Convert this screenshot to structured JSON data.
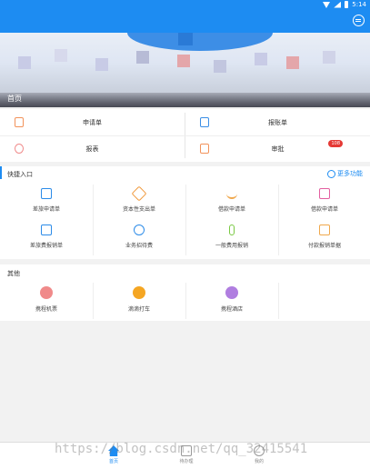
{
  "status_bar": {
    "time": "5:14"
  },
  "banner": {
    "label": "首页"
  },
  "main_grid": [
    {
      "label": "申请单",
      "icon": "document-icon"
    },
    {
      "label": "报账单",
      "icon": "report-icon"
    },
    {
      "label": "报表",
      "icon": "chart-icon"
    },
    {
      "label": "审批",
      "icon": "approval-icon",
      "badge": "108"
    }
  ],
  "quick_entry": {
    "title": "快捷入口",
    "more_label": "更多功能",
    "items": [
      {
        "label": "差旅申请单",
        "icon": "briefcase-icon",
        "color": "#2b8be8"
      },
      {
        "label": "资本性支出单",
        "icon": "tag-icon",
        "color": "#f09a3e"
      },
      {
        "label": "借款申请单",
        "icon": "coins-icon",
        "color": "#f0a84c"
      },
      {
        "label": "借款申请单",
        "icon": "gift-icon",
        "color": "#e35fa0"
      },
      {
        "label": "差旅费报销单",
        "icon": "receipt-icon",
        "color": "#2b8be8"
      },
      {
        "label": "业务招待费",
        "icon": "cup-icon",
        "color": "#2b8be8"
      },
      {
        "label": "一般费用报销",
        "icon": "mic-icon",
        "color": "#7ac943"
      },
      {
        "label": "付款报销单据",
        "icon": "clipboard-icon",
        "color": "#f0a84c"
      }
    ]
  },
  "other": {
    "title": "其他",
    "items": [
      {
        "label": "携程机票",
        "icon": "plane-icon",
        "color": "#f08a8a"
      },
      {
        "label": "滴滴打车",
        "icon": "car-icon",
        "color": "#f5a623"
      },
      {
        "label": "携程酒店",
        "icon": "hotel-icon",
        "color": "#b07ee0"
      }
    ]
  },
  "tabs": [
    {
      "label": "首页",
      "icon": "home-icon",
      "active": true
    },
    {
      "label": "待办理",
      "icon": "todo-icon",
      "active": false
    },
    {
      "label": "我的",
      "icon": "user-icon",
      "active": false
    }
  ],
  "watermark": "https://blog.csdn.net/qq_32415541"
}
